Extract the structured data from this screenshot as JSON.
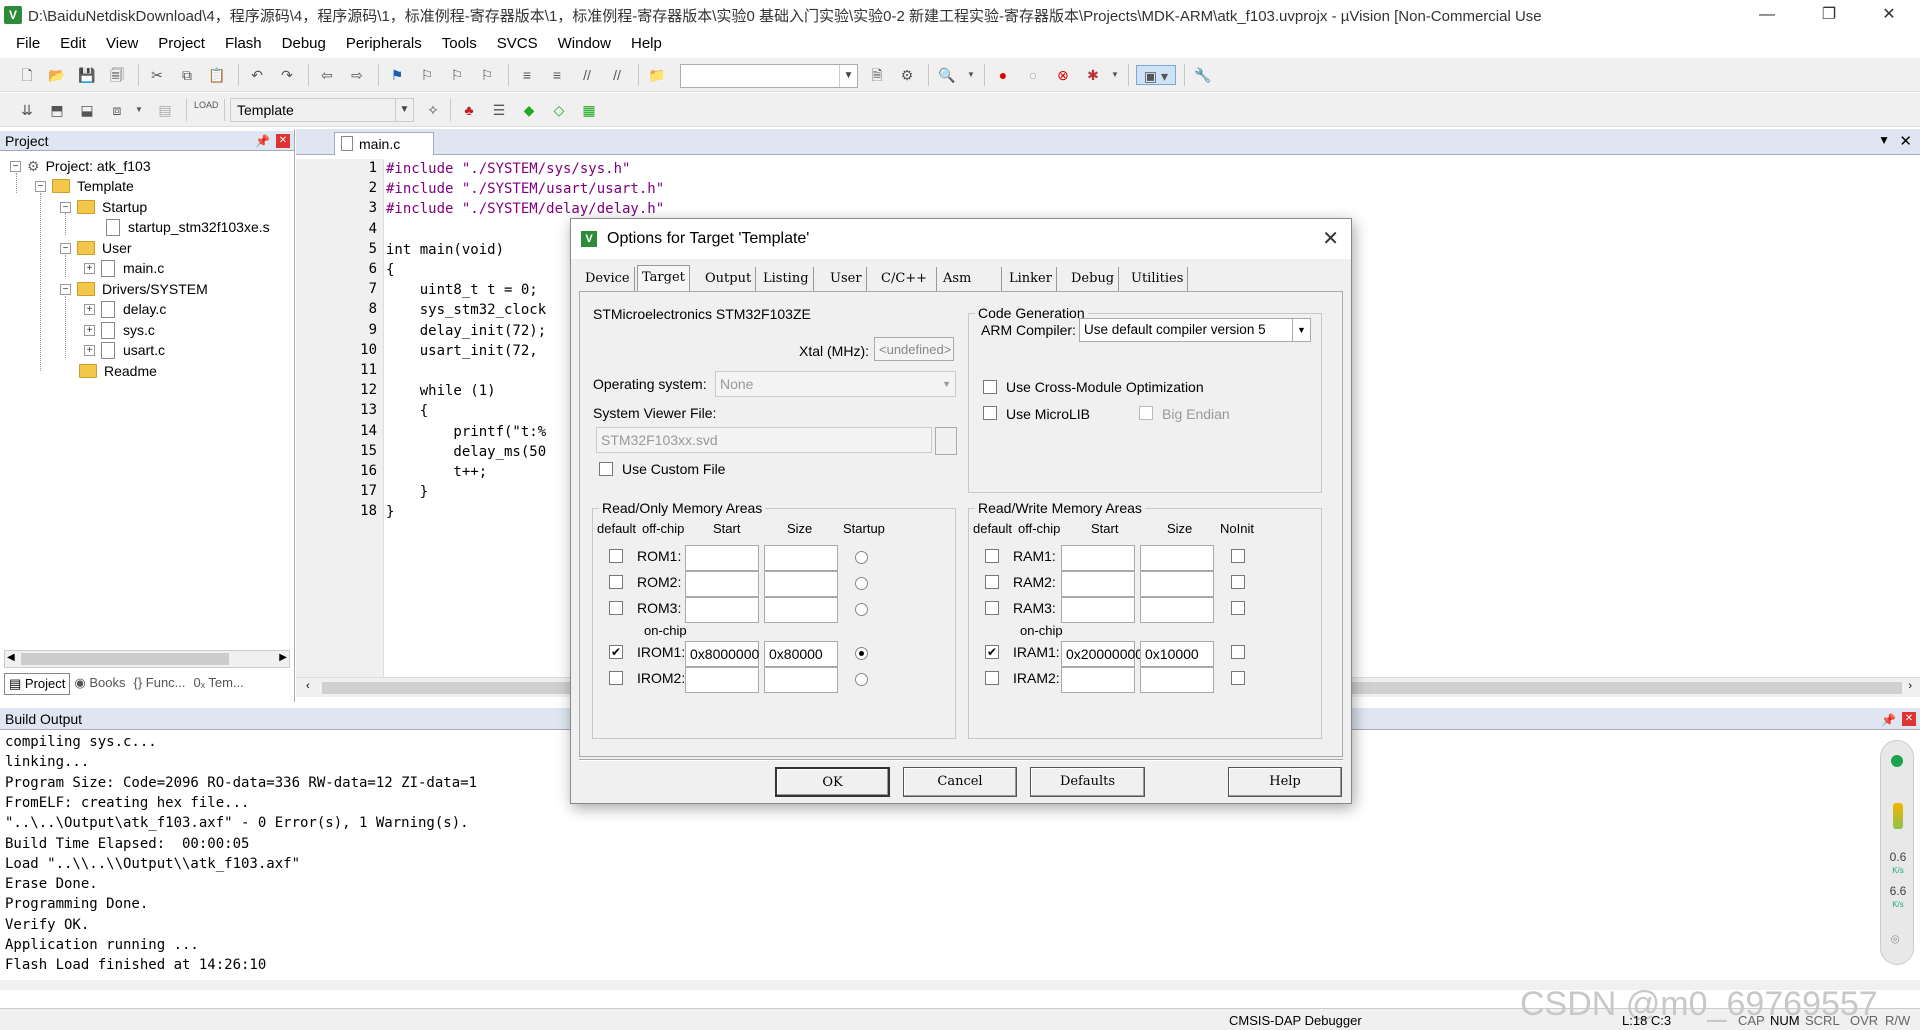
{
  "window": {
    "title": "D:\\BaiduNetdiskDownload\\4，程序源码\\4，程序源码\\1，标准例程-寄存器版本\\1，标准例程-寄存器版本\\实验0 基础入门实验\\实验0-2 新建工程实验-寄存器版本\\Projects\\MDK-ARM\\atk_f103.uvprojx - µVision  [Non-Commercial Use",
    "min": "—",
    "max": "❐",
    "close": "✕"
  },
  "menu": [
    "File",
    "Edit",
    "View",
    "Project",
    "Flash",
    "Debug",
    "Peripherals",
    "Tools",
    "SVCS",
    "Window",
    "Help"
  ],
  "toolbar2": {
    "target": "Template"
  },
  "project": {
    "header": "Project",
    "root": "Project: atk_f103",
    "target": "Template",
    "groups": [
      {
        "name": "Startup",
        "files": [
          "startup_stm32f103xe.s"
        ]
      },
      {
        "name": "User",
        "files": [
          "main.c"
        ]
      },
      {
        "name": "Drivers/SYSTEM",
        "files": [
          "delay.c",
          "sys.c",
          "usart.c"
        ]
      },
      {
        "name": "Readme",
        "files": []
      }
    ],
    "tabs": [
      "Project",
      "Books",
      "{} Func...",
      "0ₓ Tem..."
    ]
  },
  "editor": {
    "tab": "main.c",
    "lines": [
      "#include \"./SYSTEM/sys/sys.h\"",
      "#include \"./SYSTEM/usart/usart.h\"",
      "#include \"./SYSTEM/delay/delay.h\"",
      "",
      "int main(void)",
      "{",
      "    uint8_t t = 0;",
      "    sys_stm32_clock",
      "    delay_init(72);",
      "    usart_init(72,",
      "",
      "    while (1)",
      "    {",
      "        printf(\"t:%",
      "        delay_ms(50",
      "        t++;",
      "    }",
      "}"
    ]
  },
  "build": {
    "header": "Build Output",
    "lines": [
      "compiling sys.c...",
      "linking...",
      "Program Size: Code=2096 RO-data=336 RW-data=12 ZI-data=1",
      "FromELF: creating hex file...",
      "\"..\\..\\Output\\atk_f103.axf\" - 0 Error(s), 1 Warning(s).",
      "Build Time Elapsed:  00:00:05",
      "Load \"..\\\\..\\\\Output\\\\atk_f103.axf\"",
      "Erase Done.",
      "Programming Done.",
      "Verify OK.",
      "Application running ...",
      "Flash Load finished at 14:26:10"
    ]
  },
  "status": {
    "debugger": "CMSIS-DAP Debugger",
    "pos": "L:18 C:3",
    "caps": "CAP",
    "num": "NUM",
    "scrl": "SCRL",
    "ovr": "OVR",
    "rw": "R/W",
    "watermark": "CSDN @m0_69769557"
  },
  "net": {
    "up": "0.6",
    "up_unit": "K/s",
    "down": "6.6",
    "down_unit": "K/s"
  },
  "dialog": {
    "title": "Options for Target 'Template'",
    "tabs": [
      "Device",
      "Target",
      "Output",
      "Listing",
      "User",
      "C/C++",
      "Asm",
      "Linker",
      "Debug",
      "Utilities"
    ],
    "device": "STMicroelectronics STM32F103ZE",
    "xtal_label": "Xtal (MHz):",
    "xtal_value": "<undefined>",
    "os_label": "Operating system:",
    "os_value": "None",
    "svf_label": "System Viewer File:",
    "svf_value": "STM32F103xx.svd",
    "custom_file": "Use Custom File",
    "codegen": {
      "label": "Code Generation",
      "compiler_label": "ARM Compiler:",
      "compiler_value": "Use default compiler version 5",
      "cross": "Use Cross-Module Optimization",
      "microlib": "Use MicroLIB",
      "bigendian": "Big Endian"
    },
    "ro": {
      "label": "Read/Only Memory Areas",
      "cols": [
        "default",
        "off-chip",
        "Start",
        "Size",
        "Startup"
      ],
      "offchip": "on-chip",
      "rows": [
        {
          "name": "ROM1:",
          "start": "",
          "size": "",
          "def": false,
          "startup": false
        },
        {
          "name": "ROM2:",
          "start": "",
          "size": "",
          "def": false,
          "startup": false
        },
        {
          "name": "ROM3:",
          "start": "",
          "size": "",
          "def": false,
          "startup": false
        },
        {
          "name": "IROM1:",
          "start": "0x8000000",
          "size": "0x80000",
          "def": true,
          "startup": true
        },
        {
          "name": "IROM2:",
          "start": "",
          "size": "",
          "def": false,
          "startup": false
        }
      ]
    },
    "rw": {
      "label": "Read/Write Memory Areas",
      "cols": [
        "default",
        "off-chip",
        "Start",
        "Size",
        "NoInit"
      ],
      "offchip": "on-chip",
      "rows": [
        {
          "name": "RAM1:",
          "start": "",
          "size": ""
        },
        {
          "name": "RAM2:",
          "start": "",
          "size": ""
        },
        {
          "name": "RAM3:",
          "start": "",
          "size": ""
        },
        {
          "name": "IRAM1:",
          "start": "0x20000000",
          "size": "0x10000",
          "def": true
        },
        {
          "name": "IRAM2:",
          "start": "",
          "size": ""
        }
      ]
    },
    "buttons": {
      "ok": "OK",
      "cancel": "Cancel",
      "defaults": "Defaults",
      "help": "Help"
    }
  }
}
